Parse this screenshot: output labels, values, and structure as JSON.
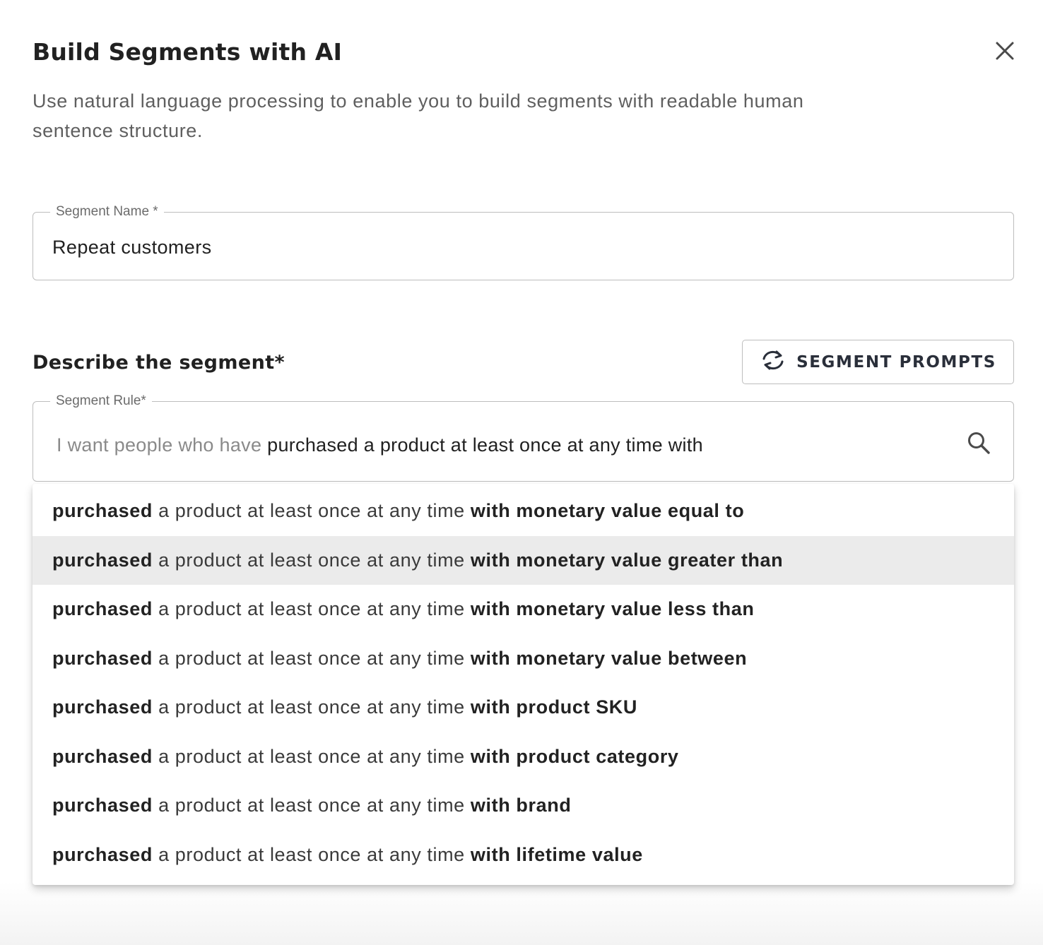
{
  "dialog": {
    "title": "Build Segments with AI",
    "description": "Use natural language processing to enable you to build segments with readable human sentence structure.",
    "close_icon": "close-icon"
  },
  "segment_name": {
    "label": "Segment Name *",
    "value": "Repeat customers"
  },
  "describe": {
    "heading": "Describe the segment*",
    "prompts_button": {
      "label": "SEGMENT PROMPTS",
      "icon": "refresh-icon"
    }
  },
  "segment_rule": {
    "label": "Segment Rule*",
    "prefix": "I want people who have",
    "value": "purchased a product at least once at any time with",
    "search_icon": "search-icon"
  },
  "options": [
    {
      "verb": "purchased",
      "middle": "a product at least once at any time",
      "tail": "with monetary value equal to",
      "highlighted": false
    },
    {
      "verb": "purchased",
      "middle": "a product at least once at any time",
      "tail": "with monetary value greater than",
      "highlighted": true
    },
    {
      "verb": "purchased",
      "middle": "a product at least once at any time",
      "tail": "with monetary value less than",
      "highlighted": false
    },
    {
      "verb": "purchased",
      "middle": "a product at least once at any time",
      "tail": "with monetary value between",
      "highlighted": false
    },
    {
      "verb": "purchased",
      "middle": "a product at least once at any time",
      "tail": "with product SKU",
      "highlighted": false
    },
    {
      "verb": "purchased",
      "middle": "a product at least once at any time",
      "tail": "with product category",
      "highlighted": false
    },
    {
      "verb": "purchased",
      "middle": "a product at least once at any time",
      "tail": "with brand",
      "highlighted": false
    },
    {
      "verb": "purchased",
      "middle": "a product at least once at any time",
      "tail": "with lifetime value",
      "highlighted": false
    }
  ],
  "colors": {
    "highlight": "#ebebeb",
    "border": "#bdbdbd",
    "text_primary": "#212121",
    "text_secondary": "#5f5f5f"
  }
}
